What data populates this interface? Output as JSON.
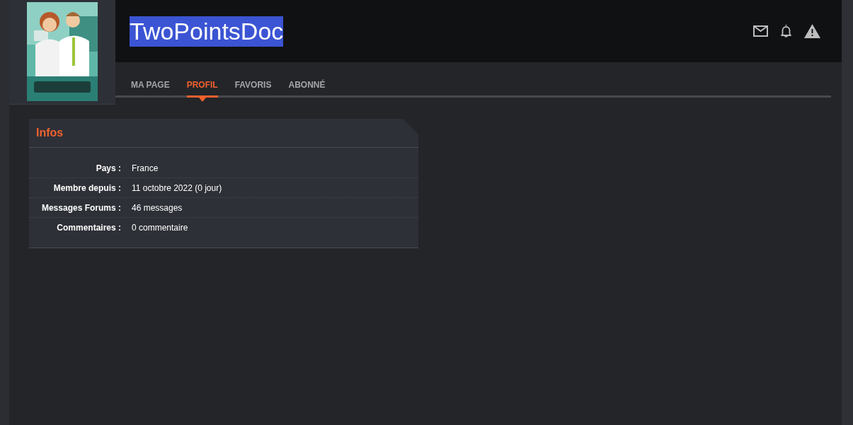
{
  "username": {
    "text": "TwoPointsDoc",
    "highlighted": true
  },
  "header_icons": [
    {
      "kind": "mail"
    },
    {
      "kind": "bell"
    },
    {
      "kind": "warning"
    }
  ],
  "tabs": [
    {
      "label": "MA PAGE",
      "selected": false
    },
    {
      "label": "PROFIL",
      "selected": true
    },
    {
      "label": "FAVORIS",
      "selected": false
    },
    {
      "label": "ABONNÉ",
      "selected": false
    }
  ],
  "infos": {
    "title": "Infos",
    "rows": [
      {
        "label": "Pays :",
        "value": "France"
      },
      {
        "label": "Membre depuis :",
        "value": "11 octobre 2022 (0 jour)"
      },
      {
        "label": "Messages Forums :",
        "value": "46 messages"
      },
      {
        "label": "Commentaires :",
        "value": "0 commentaire"
      }
    ]
  }
}
